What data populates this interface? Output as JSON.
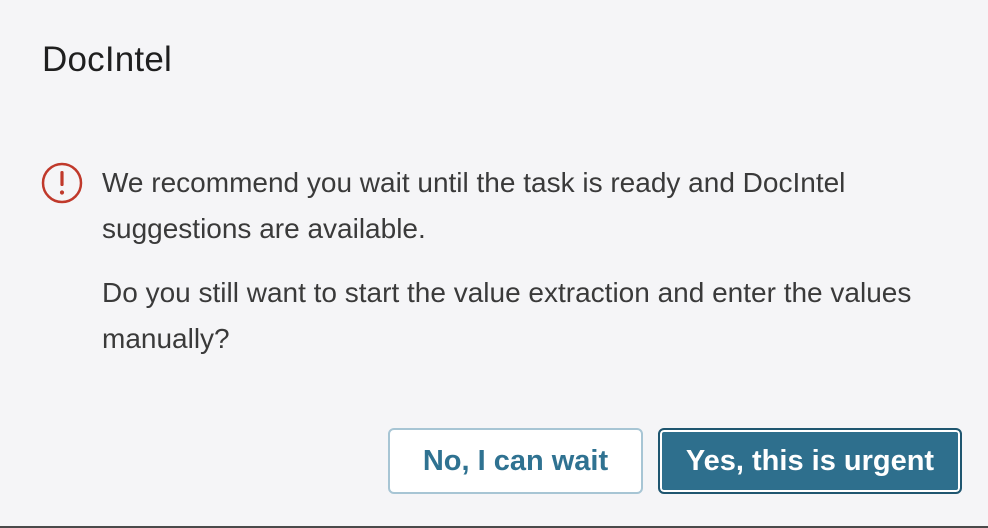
{
  "dialog": {
    "title": "DocIntel",
    "icon": "warning-exclamation-icon",
    "message_line": "We recommend you wait until the task is ready and DocIntel suggestions are available.",
    "question_line": "Do you still want to start the value extraction and enter the values manually?"
  },
  "actions": {
    "secondary_label": "No, I can wait",
    "primary_label": "Yes, this is urgent"
  },
  "colors": {
    "accent": "#2e6f8d",
    "warning": "#c0392b",
    "background": "#f5f5f7"
  }
}
